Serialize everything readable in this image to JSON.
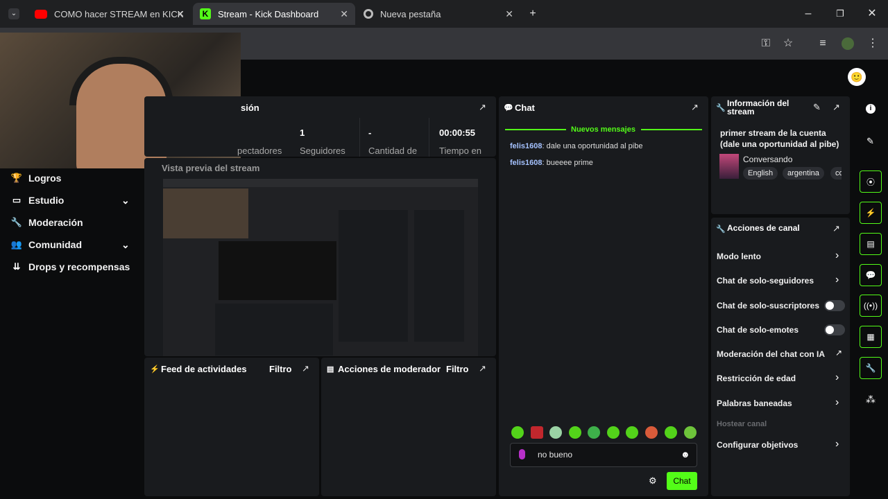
{
  "browser": {
    "tabs": [
      {
        "title": "COMO hacer STREAM en KICK"
      },
      {
        "title": "Stream - Kick Dashboard"
      },
      {
        "title": "Nueva pestaña"
      }
    ]
  },
  "sidebar": {
    "items": [
      {
        "label": "Logros"
      },
      {
        "label": "Estudio"
      },
      {
        "label": "Moderación"
      },
      {
        "label": "Comunidad"
      },
      {
        "label": "Drops y recompensas"
      }
    ]
  },
  "session": {
    "title_fragment": "sión",
    "stats": [
      {
        "value": "",
        "label": "pectadores"
      },
      {
        "value": "1",
        "label": "Seguidores"
      },
      {
        "value": "-",
        "label": "Cantidad de"
      },
      {
        "value": "00:00:55",
        "label": "Tiempo en"
      }
    ],
    "preview_title": "Vista previa del stream"
  },
  "feed": {
    "title": "Feed de actividades",
    "filter": "Filtro"
  },
  "mod_actions": {
    "title": "Acciones de moderador",
    "filter": "Filtro"
  },
  "chat": {
    "title": "Chat",
    "new_messages": "Nuevos mensajes",
    "messages": [
      {
        "user": "felis1608",
        "text": "dale una oportunidad al pibe"
      },
      {
        "user": "felis1608",
        "text": "bueeee prime"
      }
    ],
    "input_value": "no bueno",
    "send": "Chat"
  },
  "stream_info": {
    "title": "Información del stream",
    "stream_title": "primer stream de la cuenta (dale una oportunidad al pibe)",
    "category": "Conversando",
    "tags": [
      "English",
      "argentina",
      "co"
    ]
  },
  "channel_actions": {
    "title": "Acciones de canal",
    "rows": [
      {
        "label": "Modo lento"
      },
      {
        "label": "Chat de solo-seguidores"
      },
      {
        "label": "Chat de solo-suscriptores"
      },
      {
        "label": "Chat de solo-emotes"
      },
      {
        "label": "Moderación del chat con IA"
      },
      {
        "label": "Restricción de edad"
      },
      {
        "label": "Palabras baneadas"
      },
      {
        "label": "Hostear canal"
      },
      {
        "label": "Configurar objetivos"
      }
    ]
  },
  "colors": {
    "accent": "#53fc18",
    "panel": "#191b1e",
    "bg": "#0b0c0d"
  }
}
